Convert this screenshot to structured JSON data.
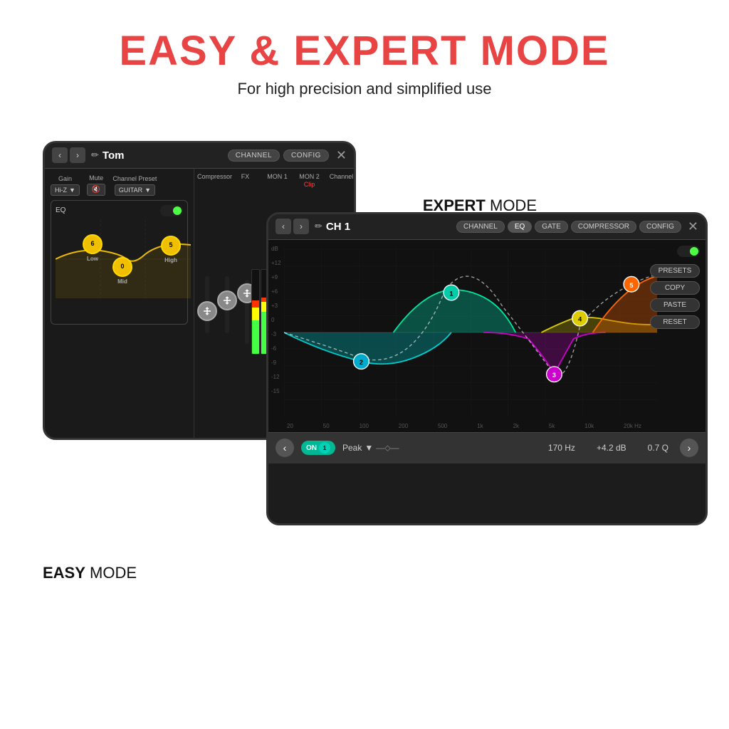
{
  "header": {
    "title": "EASY & EXPERT MODE",
    "subtitle": "For high precision and simplified use"
  },
  "easy_label": {
    "bold": "EASY",
    "rest": " MODE"
  },
  "expert_label": {
    "bold": "EXPERT",
    "rest": " MODE"
  },
  "easy_tablet": {
    "nav_prev": "‹",
    "nav_next": "›",
    "pencil": "✏",
    "title": "Tom",
    "btn_channel": "CHANNEL",
    "btn_config": "CONFIG",
    "close": "✕",
    "gain_label": "Gain",
    "mute_label": "Mute",
    "preset_label": "Channel Preset",
    "gain_value": "Hi-Z",
    "mute_icon": "🔇",
    "preset_value": "GUITAR",
    "eq_label": "EQ",
    "eq_low": "6",
    "eq_low_label": "Low",
    "eq_mid": "0",
    "eq_mid_label": "Mid",
    "eq_high": "5",
    "eq_high_label": "High",
    "channel_labels": [
      "Compressor",
      "FX",
      "MON 1",
      "MON 2",
      "Channel"
    ],
    "clip_label": "Clip"
  },
  "expert_tablet": {
    "nav_prev": "‹",
    "nav_next": "›",
    "pencil": "✏",
    "title": "CH 1",
    "btn_channel": "CHANNEL",
    "btn_eq": "EQ",
    "btn_gate": "GATE",
    "btn_compressor": "COMPRESSOR",
    "btn_config": "CONFIG",
    "close": "✕",
    "db_labels": [
      "+12",
      "+9",
      "+6",
      "+3",
      "0",
      "-3",
      "-6",
      "-9",
      "-12",
      "-15"
    ],
    "freq_labels": [
      "20",
      "50",
      "100",
      "200",
      "500",
      "1k",
      "2k",
      "5k",
      "10k",
      "20k Hz"
    ],
    "sidebar_btns": [
      "PRESETS",
      "COPY",
      "PASTE",
      "RESET"
    ],
    "band_prev": "‹",
    "band_next": "›",
    "band_on": "ON",
    "band_num": "1",
    "band_type": "Peak",
    "band_freq": "170 Hz",
    "band_db": "+4.2 dB",
    "band_q": "0.7 Q"
  }
}
